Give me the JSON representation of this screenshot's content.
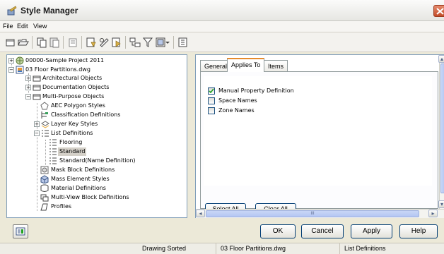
{
  "window": {
    "title": "Style Manager"
  },
  "menu": [
    "File",
    "Edit",
    "View"
  ],
  "toolbar": {
    "icons": [
      "new-icon",
      "open-icon",
      "copy-icon",
      "paste-icon",
      "purge-icon",
      "new-style-icon",
      "edit-style-icon",
      "set-from-icon",
      "sort-icon",
      "filter-icon",
      "view-icon",
      "dropdown-icon",
      "toggle-view-icon"
    ]
  },
  "tree": {
    "items": [
      {
        "label": "00000-Sample Project 2011",
        "icon": "project-icon",
        "expander": "+"
      },
      {
        "label": "03 Floor Partitions.dwg",
        "icon": "drawing-icon",
        "expander": "−"
      },
      {
        "label": "Architectural Objects",
        "icon": "folder-icon",
        "expander": "+"
      },
      {
        "label": "Documentation Objects",
        "icon": "folder-icon",
        "expander": "+"
      },
      {
        "label": "Multi-Purpose Objects",
        "icon": "folder-icon",
        "expander": "−"
      },
      {
        "label": "AEC Polygon Styles",
        "icon": "polygon-icon"
      },
      {
        "label": "Classification Definitions",
        "icon": "classification-icon"
      },
      {
        "label": "Layer Key Styles",
        "icon": "layer-key-icon",
        "expander": "+"
      },
      {
        "label": "List Definitions",
        "icon": "list-icon",
        "expander": "−"
      },
      {
        "label": "Flooring",
        "icon": "list-item-icon"
      },
      {
        "label": "Standard",
        "icon": "list-item-icon",
        "selected": true
      },
      {
        "label": "Standard(Name Definition)",
        "icon": "list-item-icon"
      },
      {
        "label": "Mask Block Definitions",
        "icon": "mask-block-icon"
      },
      {
        "label": "Mass Element Styles",
        "icon": "mass-element-icon"
      },
      {
        "label": "Material Definitions",
        "icon": "material-icon"
      },
      {
        "label": "Multi-View Block Definitions",
        "icon": "multi-view-block-icon"
      },
      {
        "label": "Profiles",
        "icon": "profile-icon"
      }
    ]
  },
  "tabs": [
    {
      "label": "General",
      "active": false
    },
    {
      "label": "Applies To",
      "active": true
    },
    {
      "label": "Items",
      "active": false
    }
  ],
  "applies_to": [
    {
      "label": "Manual Property Definition",
      "checked": true
    },
    {
      "label": "Space Names",
      "checked": false
    },
    {
      "label": "Zone Names",
      "checked": false
    }
  ],
  "panel_buttons": {
    "select_all": "Select All",
    "clear_all": "Clear All"
  },
  "scroll": {
    "h_grip": "III"
  },
  "dialog_buttons": {
    "ok": "OK",
    "cancel": "Cancel",
    "apply": "Apply",
    "help": "Help"
  },
  "status": {
    "sort": "Drawing Sorted",
    "drawing": "03 Floor Partitions.dwg",
    "type": "List Definitions"
  },
  "colors": {
    "close": "#c24c29",
    "active_tab": "#e68b2c",
    "check": "#21a121",
    "border": "#7f9db9"
  }
}
